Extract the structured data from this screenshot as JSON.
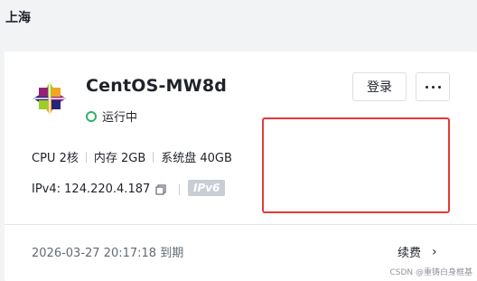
{
  "region": {
    "title": "上海"
  },
  "instance": {
    "name": "CentOS-MW8d",
    "status_text": "运行中",
    "status_color": "#2fb36b",
    "os_icon": "centos-logo-icon",
    "actions": {
      "login_label": "登录",
      "more_icon": "more-horizontal-icon"
    },
    "specs": {
      "cpu": "CPU 2核",
      "memory": "内存 2GB",
      "disk": "系统盘 40GB"
    },
    "ipv4": "IPv4: 124.220.4.187",
    "ipv6_badge": "IPv6",
    "expire_text": "2026-03-27 20:17:18 到期",
    "renew_label": "续费"
  },
  "highlight_color": "#e53935",
  "watermark": "CSDN @重铸白身框基"
}
